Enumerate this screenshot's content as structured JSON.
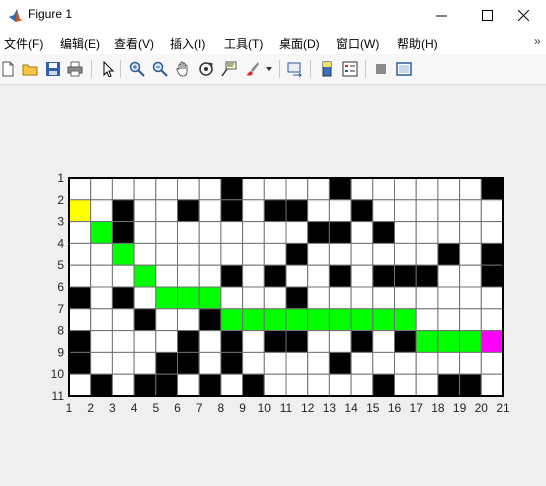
{
  "window": {
    "title": "Figure 1",
    "controls": {
      "minimize": "─",
      "maximize": "☐",
      "close": "✕"
    }
  },
  "menu": {
    "items": [
      {
        "label": "文件(F)"
      },
      {
        "label": "编辑(E)"
      },
      {
        "label": "查看(V)"
      },
      {
        "label": "插入(I)"
      },
      {
        "label": "工具(T)"
      },
      {
        "label": "桌面(D)"
      },
      {
        "label": "窗口(W)"
      },
      {
        "label": "帮助(H)"
      }
    ],
    "overflow": "»"
  },
  "toolbar": {
    "buttons": [
      {
        "icon": "new-figure-icon"
      },
      {
        "icon": "open-file-icon"
      },
      {
        "icon": "save-icon"
      },
      {
        "icon": "print-icon"
      },
      {
        "icon": "edit-plot-arrow-icon"
      },
      {
        "icon": "zoom-in-icon"
      },
      {
        "icon": "zoom-out-icon"
      },
      {
        "icon": "pan-hand-icon"
      },
      {
        "icon": "rotate-3d-icon"
      },
      {
        "icon": "data-cursor-icon"
      },
      {
        "icon": "brush-icon"
      },
      {
        "icon": "link-plot-icon"
      },
      {
        "icon": "insert-colorbar-icon"
      },
      {
        "icon": "insert-legend-icon"
      },
      {
        "icon": "hide-plot-tools-icon"
      },
      {
        "icon": "show-plot-tools-icon"
      }
    ]
  },
  "chart_data": {
    "type": "heatmap",
    "title": "",
    "xlabel": "",
    "ylabel": "",
    "x_ticks": [
      "1",
      "2",
      "3",
      "4",
      "5",
      "6",
      "7",
      "8",
      "9",
      "10",
      "11",
      "12",
      "13",
      "14",
      "15",
      "16",
      "17",
      "18",
      "19",
      "20",
      "21"
    ],
    "y_ticks": [
      "1",
      "2",
      "3",
      "4",
      "5",
      "6",
      "7",
      "8",
      "9",
      "10",
      "11"
    ],
    "xlim": [
      1,
      21
    ],
    "ylim": [
      1,
      11
    ],
    "y_direction": "reverse",
    "grid": true,
    "colors": {
      "free": "#ffffff",
      "obstacle": "#000000",
      "start": "#ffff00",
      "goal": "#ff00ff",
      "path": "#00ff00",
      "gridline": "#707070"
    },
    "cell_legend": {
      "W": "free",
      "B": "obstacle",
      "S": "start",
      "E": "goal",
      "P": "path"
    },
    "rows": [
      "WWWWWWWBWWWWBWWWWWWB",
      "SWBWWBWBWBBWWBWWWWWW",
      "WPBWWWWWWWWBBWBWWWWW",
      "WWPWWWWWWWBWWWWWWBWB",
      "WWWPWWWBWBWWBWBBBWWB",
      "BWBWPPPWWWBWWWWWWWWW",
      "WWWBWWBPPPPPPPPPWWWW",
      "BWWWWBWBWBBWWBWBPPPE",
      "BWWWBBWBWWWWBWWWWWWW",
      "WBWBBWBWBWWWWWBWWBBW"
    ]
  }
}
